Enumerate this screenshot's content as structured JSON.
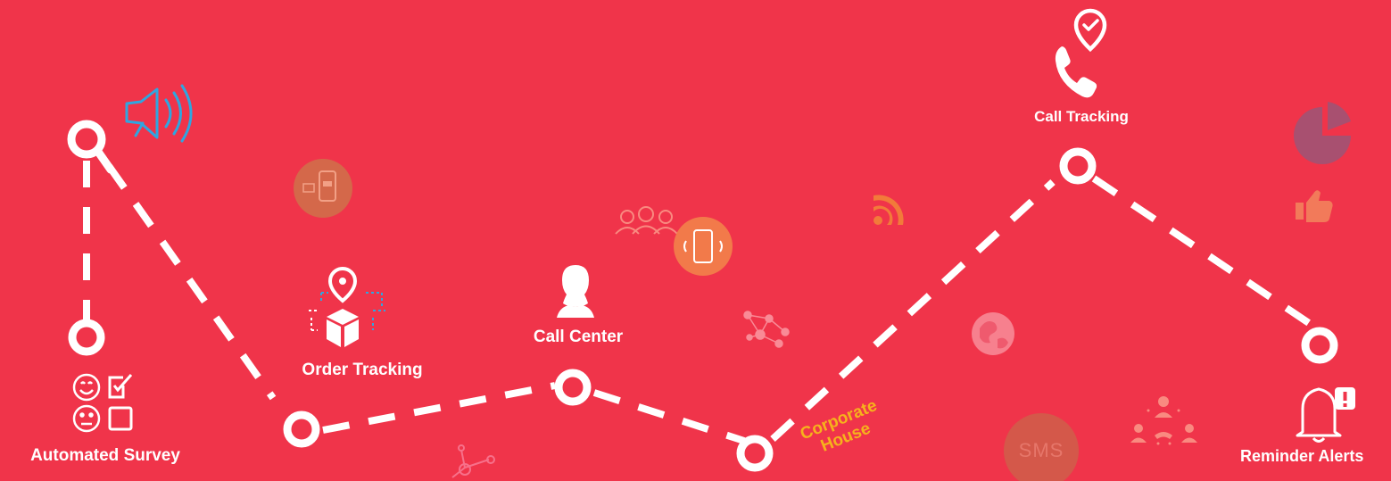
{
  "background_color": "#f0344a",
  "path_color": "#ffffff",
  "accent_color": "#f6b21c",
  "icon_accent_color": "#2fa6e0",
  "milestones": {
    "automated_survey": {
      "label": "Automated Survey",
      "icons": [
        "megaphone-icon",
        "smiley-happy-icon",
        "checkbox-checked-icon",
        "smiley-neutral-icon",
        "checkbox-empty-icon"
      ]
    },
    "order_tracking": {
      "label": "Order Tracking",
      "icon": "location-box-icon"
    },
    "call_center": {
      "label": "Call Center",
      "icon": "agent-icon"
    },
    "corporate_house": {
      "label_line1": "Corporate",
      "label_line2": "House"
    },
    "call_tracking": {
      "label": "Call Tracking",
      "icon": "phone-location-icon"
    },
    "reminder_alerts": {
      "label": "Reminder Alerts",
      "icon": "bell-alert-icon"
    }
  },
  "decorations": {
    "sms_badge": "SMS",
    "icons": [
      "mobile-message-icon",
      "users-group-icon",
      "mobile-vibrate-icon",
      "rss-icon",
      "network-icon",
      "globe-icon",
      "conference-icon",
      "pie-chart-icon",
      "thumbs-up-icon",
      "share-nodes-icon"
    ]
  }
}
